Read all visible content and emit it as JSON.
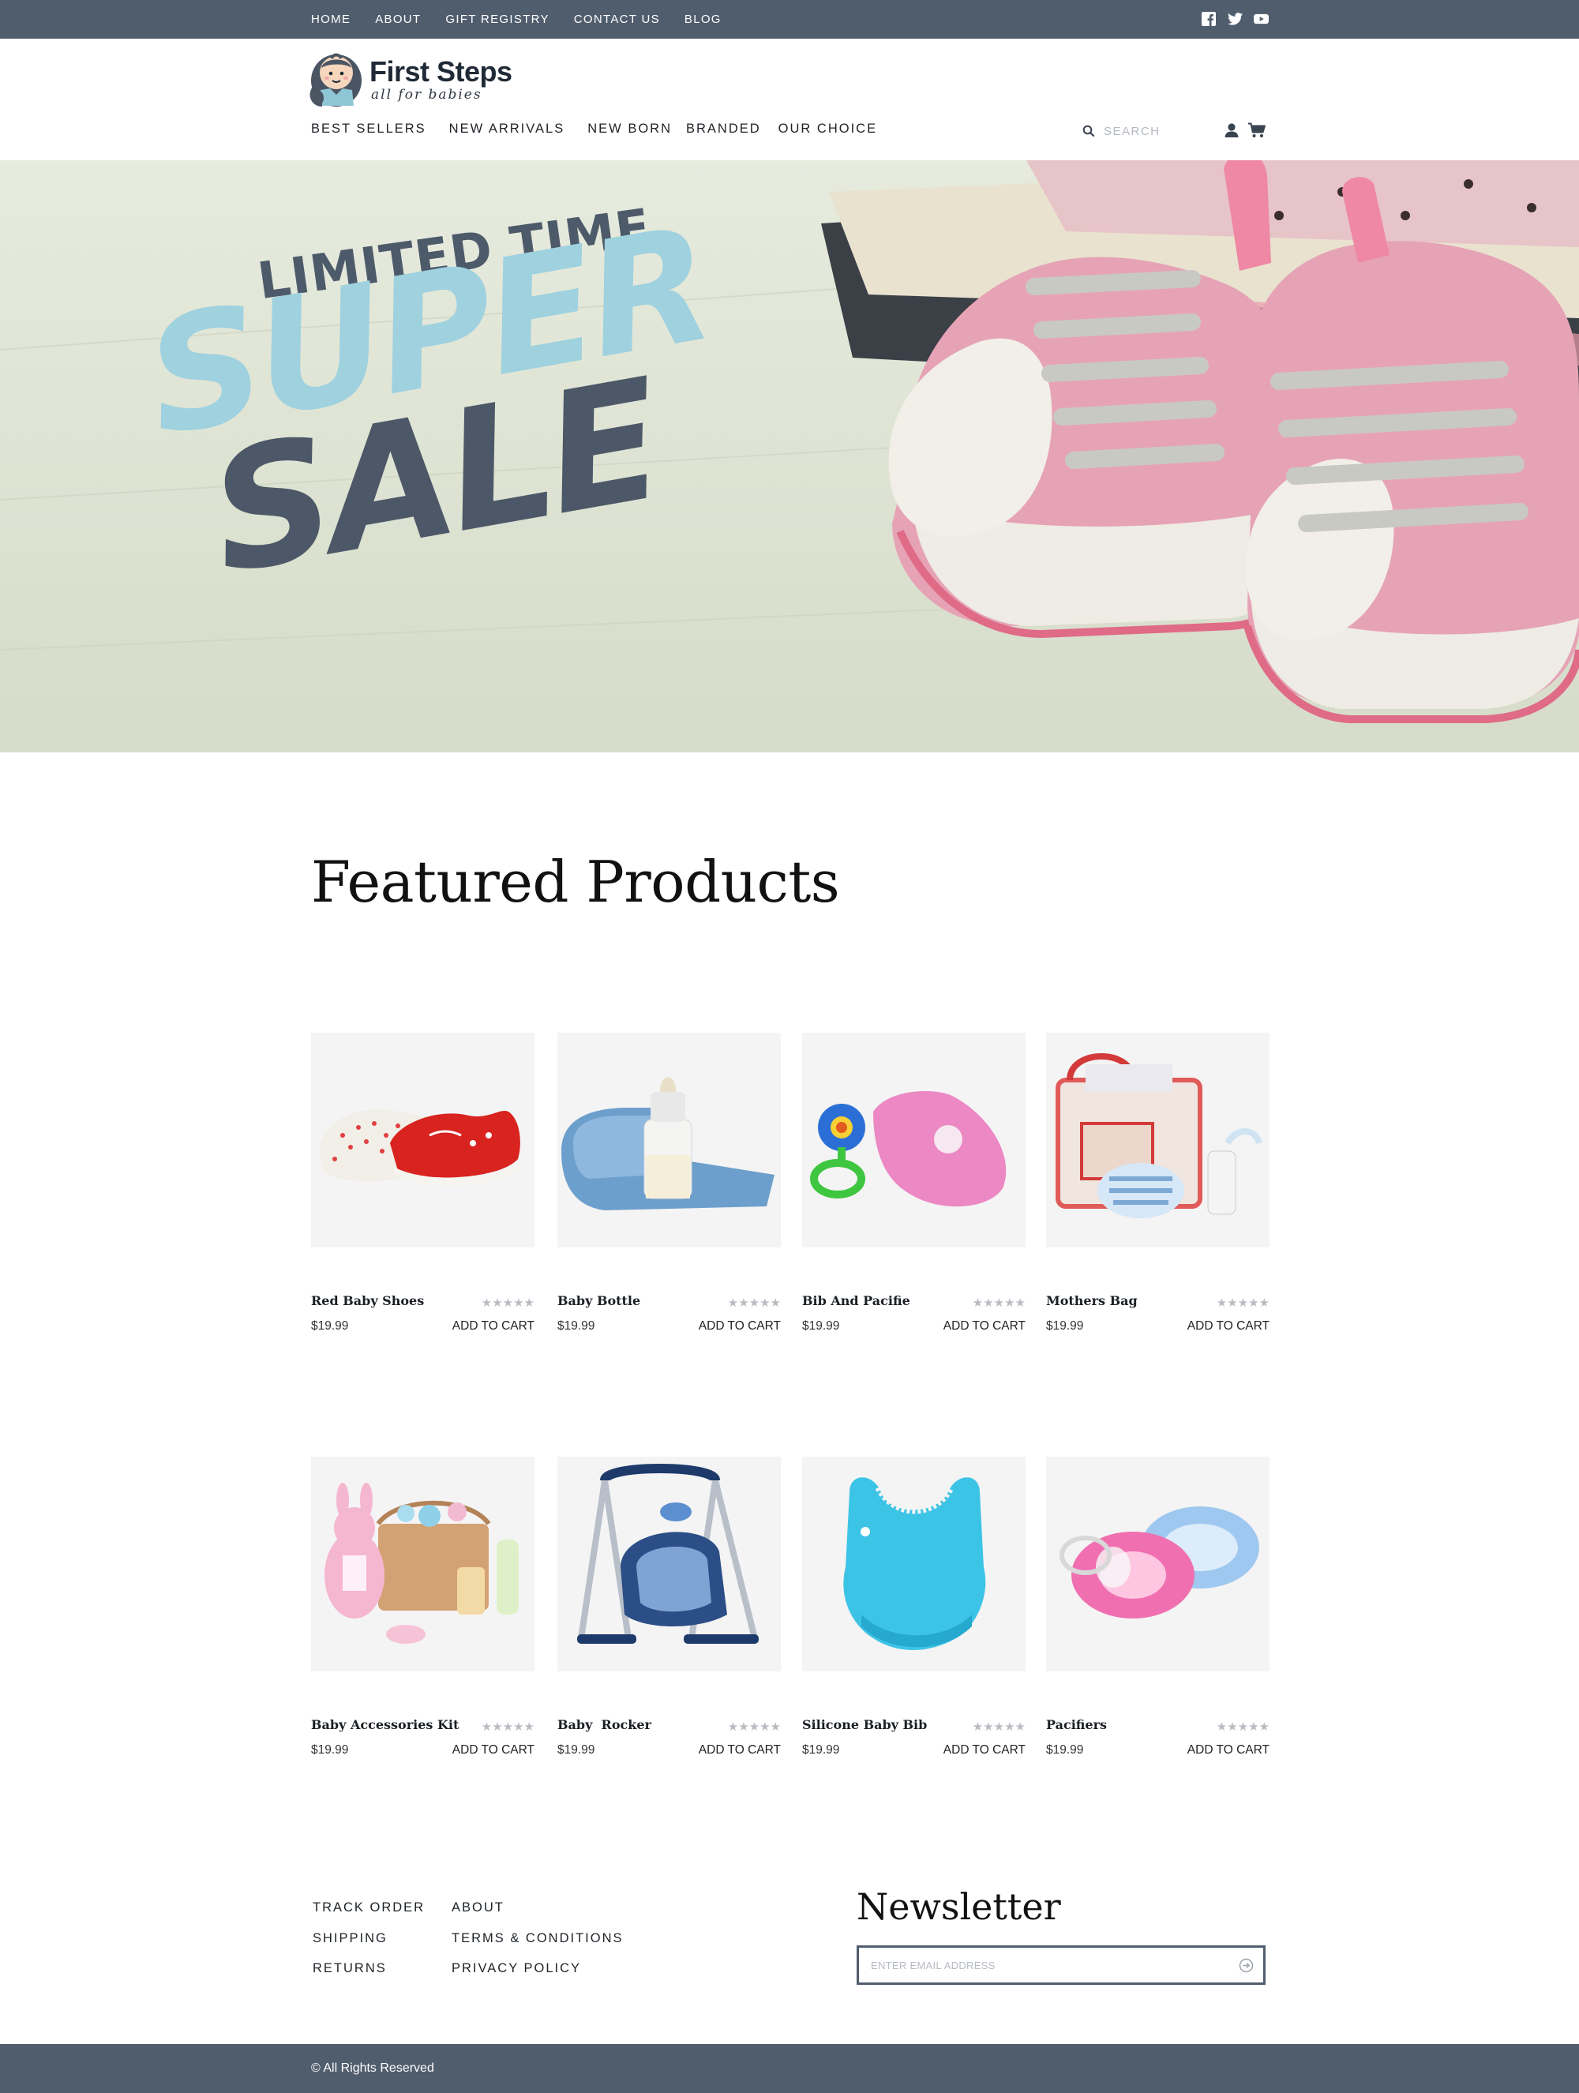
{
  "topbar": {
    "links": [
      "HOME",
      "ABOUT",
      "GIFT REGISTRY",
      "CONTACT US",
      "BLOG"
    ],
    "social": [
      "facebook-icon",
      "twitter-icon",
      "youtube-icon"
    ],
    "bg_color": "#505d6d"
  },
  "header": {
    "brand": "First Steps",
    "tagline": "all for babies",
    "nav": [
      "BEST SELLERS",
      "NEW ARRIVALS",
      "NEW BORN",
      "BRANDED",
      "OUR CHOICE"
    ],
    "search_placeholder": "SEARCH"
  },
  "hero": {
    "line1": "LIMITED TIME",
    "line2": "SUPER",
    "line3": "SALE",
    "accent": "#9fd1df",
    "dark": "#4c5868"
  },
  "featured": {
    "title": "Featured Products",
    "add_label": "ADD TO CART",
    "products": [
      {
        "name": "Red Baby Shoes",
        "price": "$19.99",
        "rating": 5
      },
      {
        "name": "Baby Bottle",
        "price": "$19.99",
        "rating": 5
      },
      {
        "name": "Bib And Pacifie",
        "price": "$19.99",
        "rating": 5
      },
      {
        "name": "Mothers Bag",
        "price": "$19.99",
        "rating": 5
      },
      {
        "name": "Baby Accessories Kit",
        "price": "$19.99",
        "rating": 5
      },
      {
        "name": "Baby  Rocker",
        "price": "$19.99",
        "rating": 5
      },
      {
        "name": "Silicone Baby Bib",
        "price": "$19.99",
        "rating": 5
      },
      {
        "name": "Pacifiers",
        "price": "$19.99",
        "rating": 5
      }
    ]
  },
  "footer": {
    "col1": [
      "TRACK ORDER",
      "SHIPPING",
      "RETURNS"
    ],
    "col2": [
      "ABOUT",
      "TERMS & CONDITIONS",
      "PRIVACY POLICY"
    ],
    "newsletter_title": "Newsletter",
    "email_placeholder": "ENTER EMAIL ADDRESS",
    "copyright": "© All Rights Reserved"
  }
}
